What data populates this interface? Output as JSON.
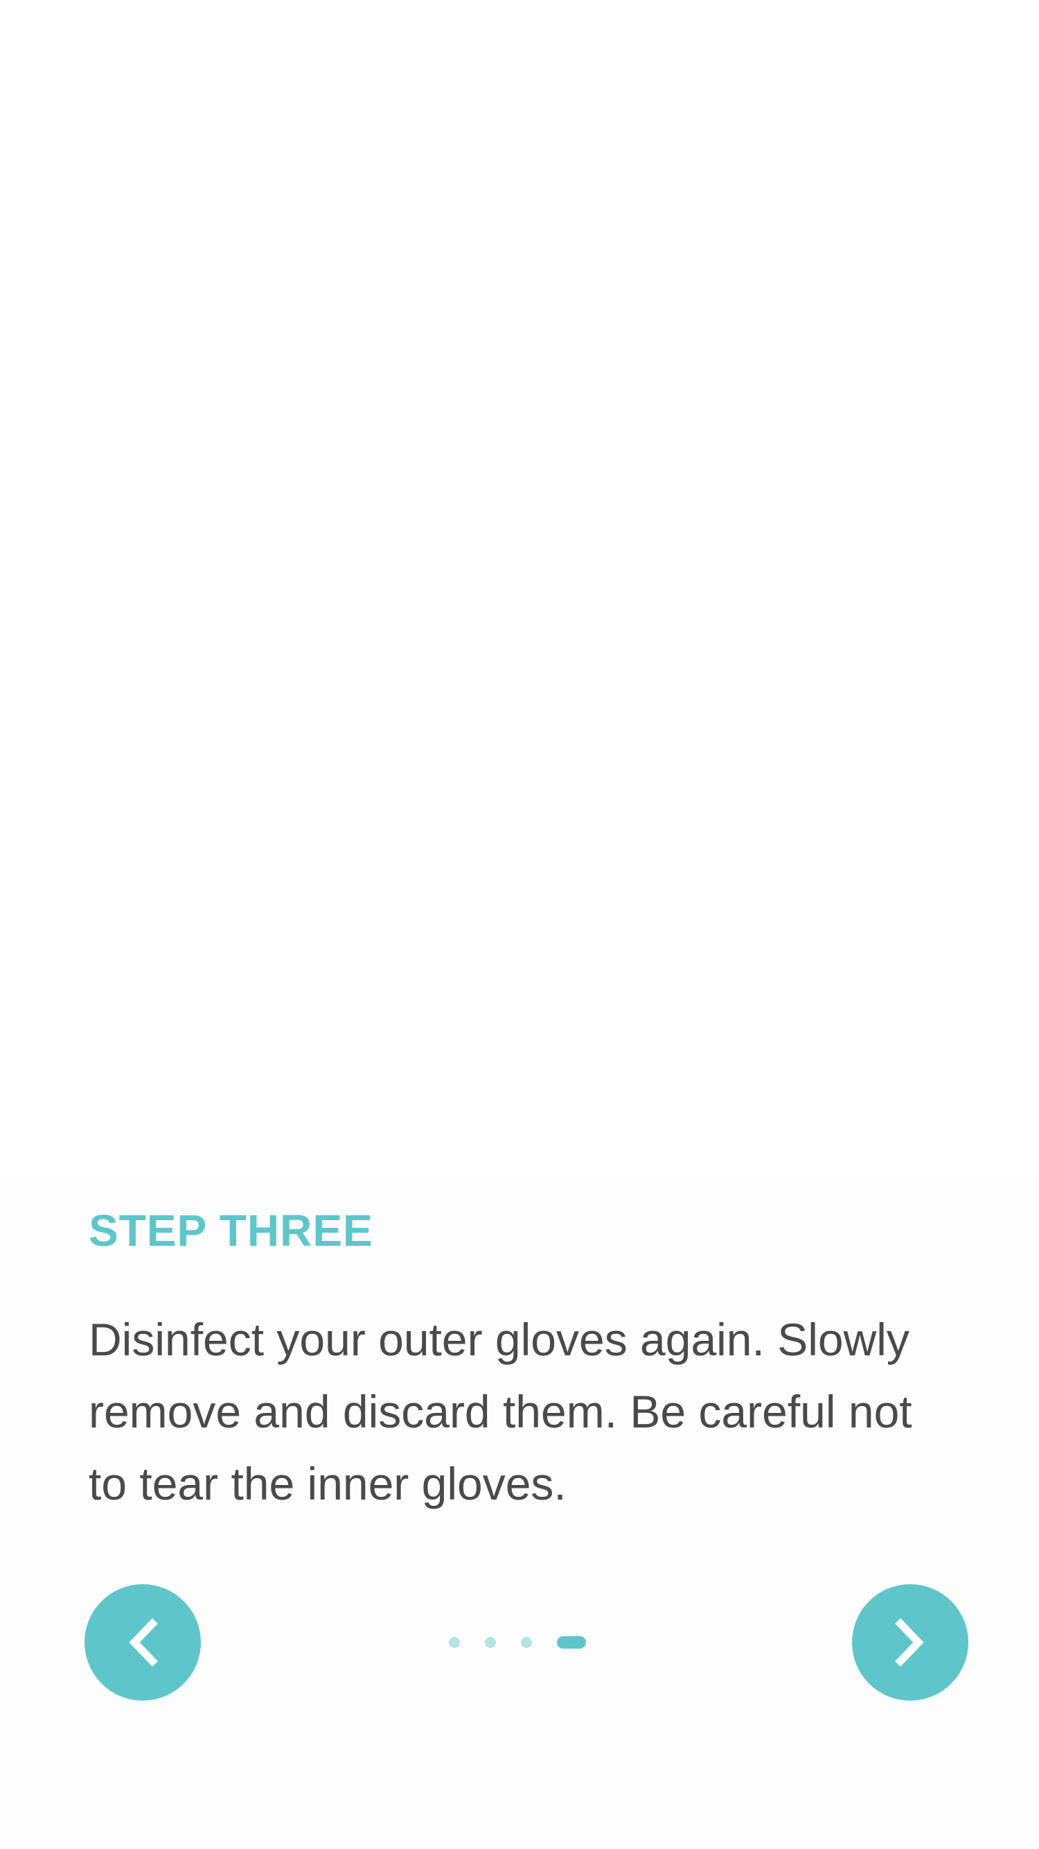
{
  "step": {
    "title": "STEP THREE",
    "description": "Disinfect your outer gloves again. Slowly remove and discard them. Be careful not to tear the inner gloves."
  },
  "navigation": {
    "prev_icon": "chevron-left-icon",
    "next_icon": "chevron-right-icon",
    "page_count": 4,
    "current_page": 4
  },
  "colors": {
    "accent": "#5ec6cb",
    "accent_light": "#b3e3e5",
    "text": "#4a4a4a",
    "background": "#fdfdfd"
  }
}
